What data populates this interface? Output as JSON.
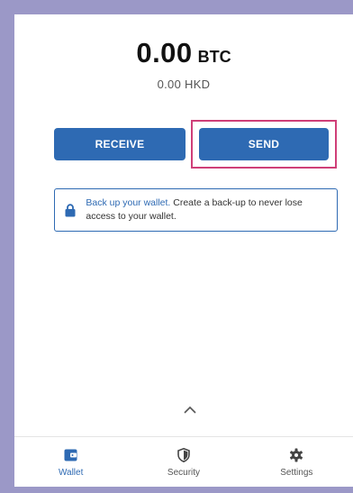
{
  "balance": {
    "amount": "0.00",
    "unit": "BTC",
    "fiat": "0.00 HKD"
  },
  "actions": {
    "receive_label": "RECEIVE",
    "send_label": "SEND"
  },
  "backup": {
    "link_text": "Back up your wallet.",
    "message": "Create a back-up to never lose access to your wallet.",
    "icon": "lock-icon"
  },
  "nav": {
    "items": [
      {
        "label": "Wallet",
        "icon": "wallet-icon",
        "active": true
      },
      {
        "label": "Security",
        "icon": "shield-icon",
        "active": false
      },
      {
        "label": "Settings",
        "icon": "gear-icon",
        "active": false
      }
    ]
  },
  "colors": {
    "accent": "#2e6ab3",
    "highlight": "#cf3f78",
    "frame": "#9b98c7",
    "inactive_icon": "#444444"
  }
}
